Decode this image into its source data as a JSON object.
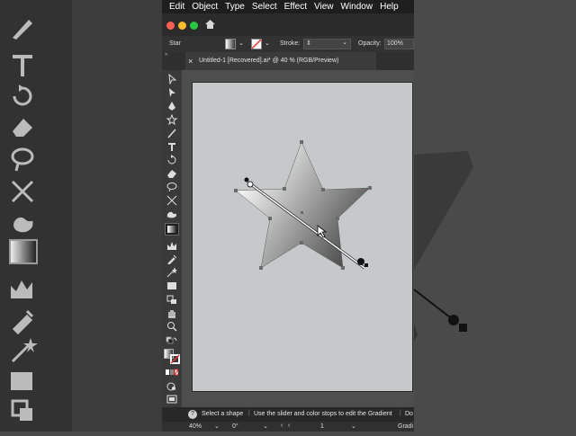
{
  "menu": [
    "Edit",
    "Object",
    "Type",
    "Select",
    "Effect",
    "View",
    "Window",
    "Help"
  ],
  "window": {
    "traffic_colors": [
      "#ff5f57",
      "#febc2e",
      "#28c840"
    ]
  },
  "control_bar": {
    "object_type": "Star",
    "stroke_label": "Stroke:",
    "opacity_label": "Opacity:",
    "opacity_value": "100%"
  },
  "document_tab": {
    "close": "×",
    "title": "Untitled-1 [Recovered].ai* @ 40 % (RGB/Preview)"
  },
  "status_bar": {
    "help": "?",
    "hint1": "Select a shape",
    "hint2": "Use the slider and color stops to edit the Gradient",
    "hint3": "Do"
  },
  "bottom_bar": {
    "zoom": "40%",
    "rotation": "0°",
    "artboard": "1",
    "mode": "Gradi"
  },
  "colors": {
    "artboard": "#c5c9ca",
    "gradient_start": "#ffffff",
    "gradient_end": "#3a3a3a",
    "stroke_none": "#e03030"
  }
}
